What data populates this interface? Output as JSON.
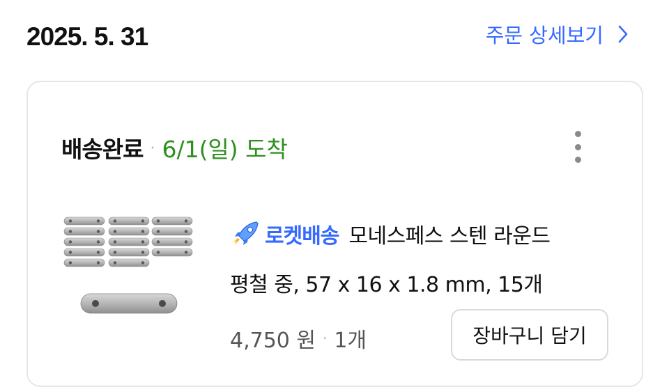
{
  "header": {
    "order_date": "2025. 5. 31",
    "detail_link": "주문 상세보기"
  },
  "shipment": {
    "status": "배송완료",
    "separator": "·",
    "arrival": "6/1(일) 도착"
  },
  "product": {
    "badge_label": "로켓배송",
    "name_line1": "모네스페스 스텐 라운드",
    "name_line2": "평철 중, 57 x 16 x 1.8 mm, 15개",
    "price": "4,750 원",
    "separator": "·",
    "quantity": "1개",
    "cart_button": "장바구니 담기"
  },
  "colors": {
    "link_blue": "#346aff",
    "arrival_green": "#2f8f1f"
  },
  "icons": {
    "detail_link": "chevron-right-icon",
    "more": "more-vertical-icon",
    "badge": "rocket-icon"
  }
}
